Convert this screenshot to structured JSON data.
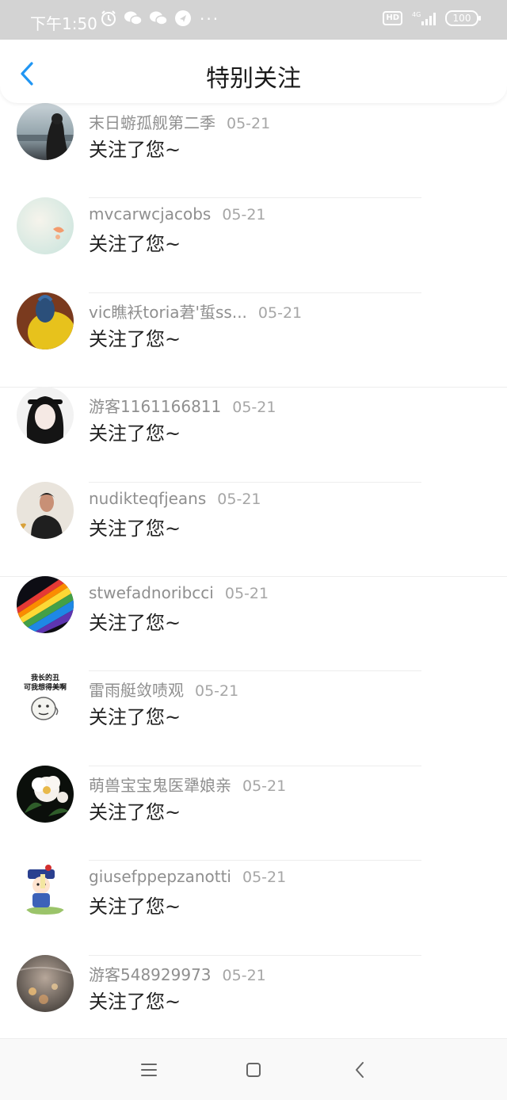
{
  "status_bar": {
    "time": "下午1:50",
    "dots": "···",
    "hd": "HD",
    "network": "4G",
    "battery": "100"
  },
  "header": {
    "title": "特别关注",
    "back_icon": "chevron-left-icon"
  },
  "colors": {
    "accent": "#2196f3",
    "status_bg": "#d3d3d3"
  },
  "notifications": [
    {
      "name": "末日蝣孤舰第二季",
      "date": "05-21",
      "message": "关注了您~"
    },
    {
      "name": "mvcarwcjacobs",
      "date": "05-21",
      "message": "关注了您~"
    },
    {
      "name": "vic瞧袄toria莙'蜇ss...",
      "date": "05-21",
      "message": "关注了您~"
    },
    {
      "name": "游客1161166811",
      "date": "05-21",
      "message": "关注了您~"
    },
    {
      "name": "nudikteqfjeans",
      "date": "05-21",
      "message": "关注了您~"
    },
    {
      "name": "stwefadnoribcci",
      "date": "05-21",
      "message": "关注了您~"
    },
    {
      "name": "雷雨艇敛啧观",
      "date": "05-21",
      "message": "关注了您~"
    },
    {
      "name": "萌兽宝宝鬼医犟娘亲",
      "date": "05-21",
      "message": "关注了您~"
    },
    {
      "name": "giusefppepzanotti",
      "date": "05-21",
      "message": "关注了您~"
    },
    {
      "name": "游客548929973",
      "date": "05-21",
      "message": "关注了您~"
    }
  ],
  "meme_avatar_text": [
    "我长的丑",
    "可我想得美啊"
  ],
  "navbar": {
    "menu_icon": "menu-icon",
    "home_icon": "square-home-icon",
    "back_icon": "back-arrow-icon"
  }
}
